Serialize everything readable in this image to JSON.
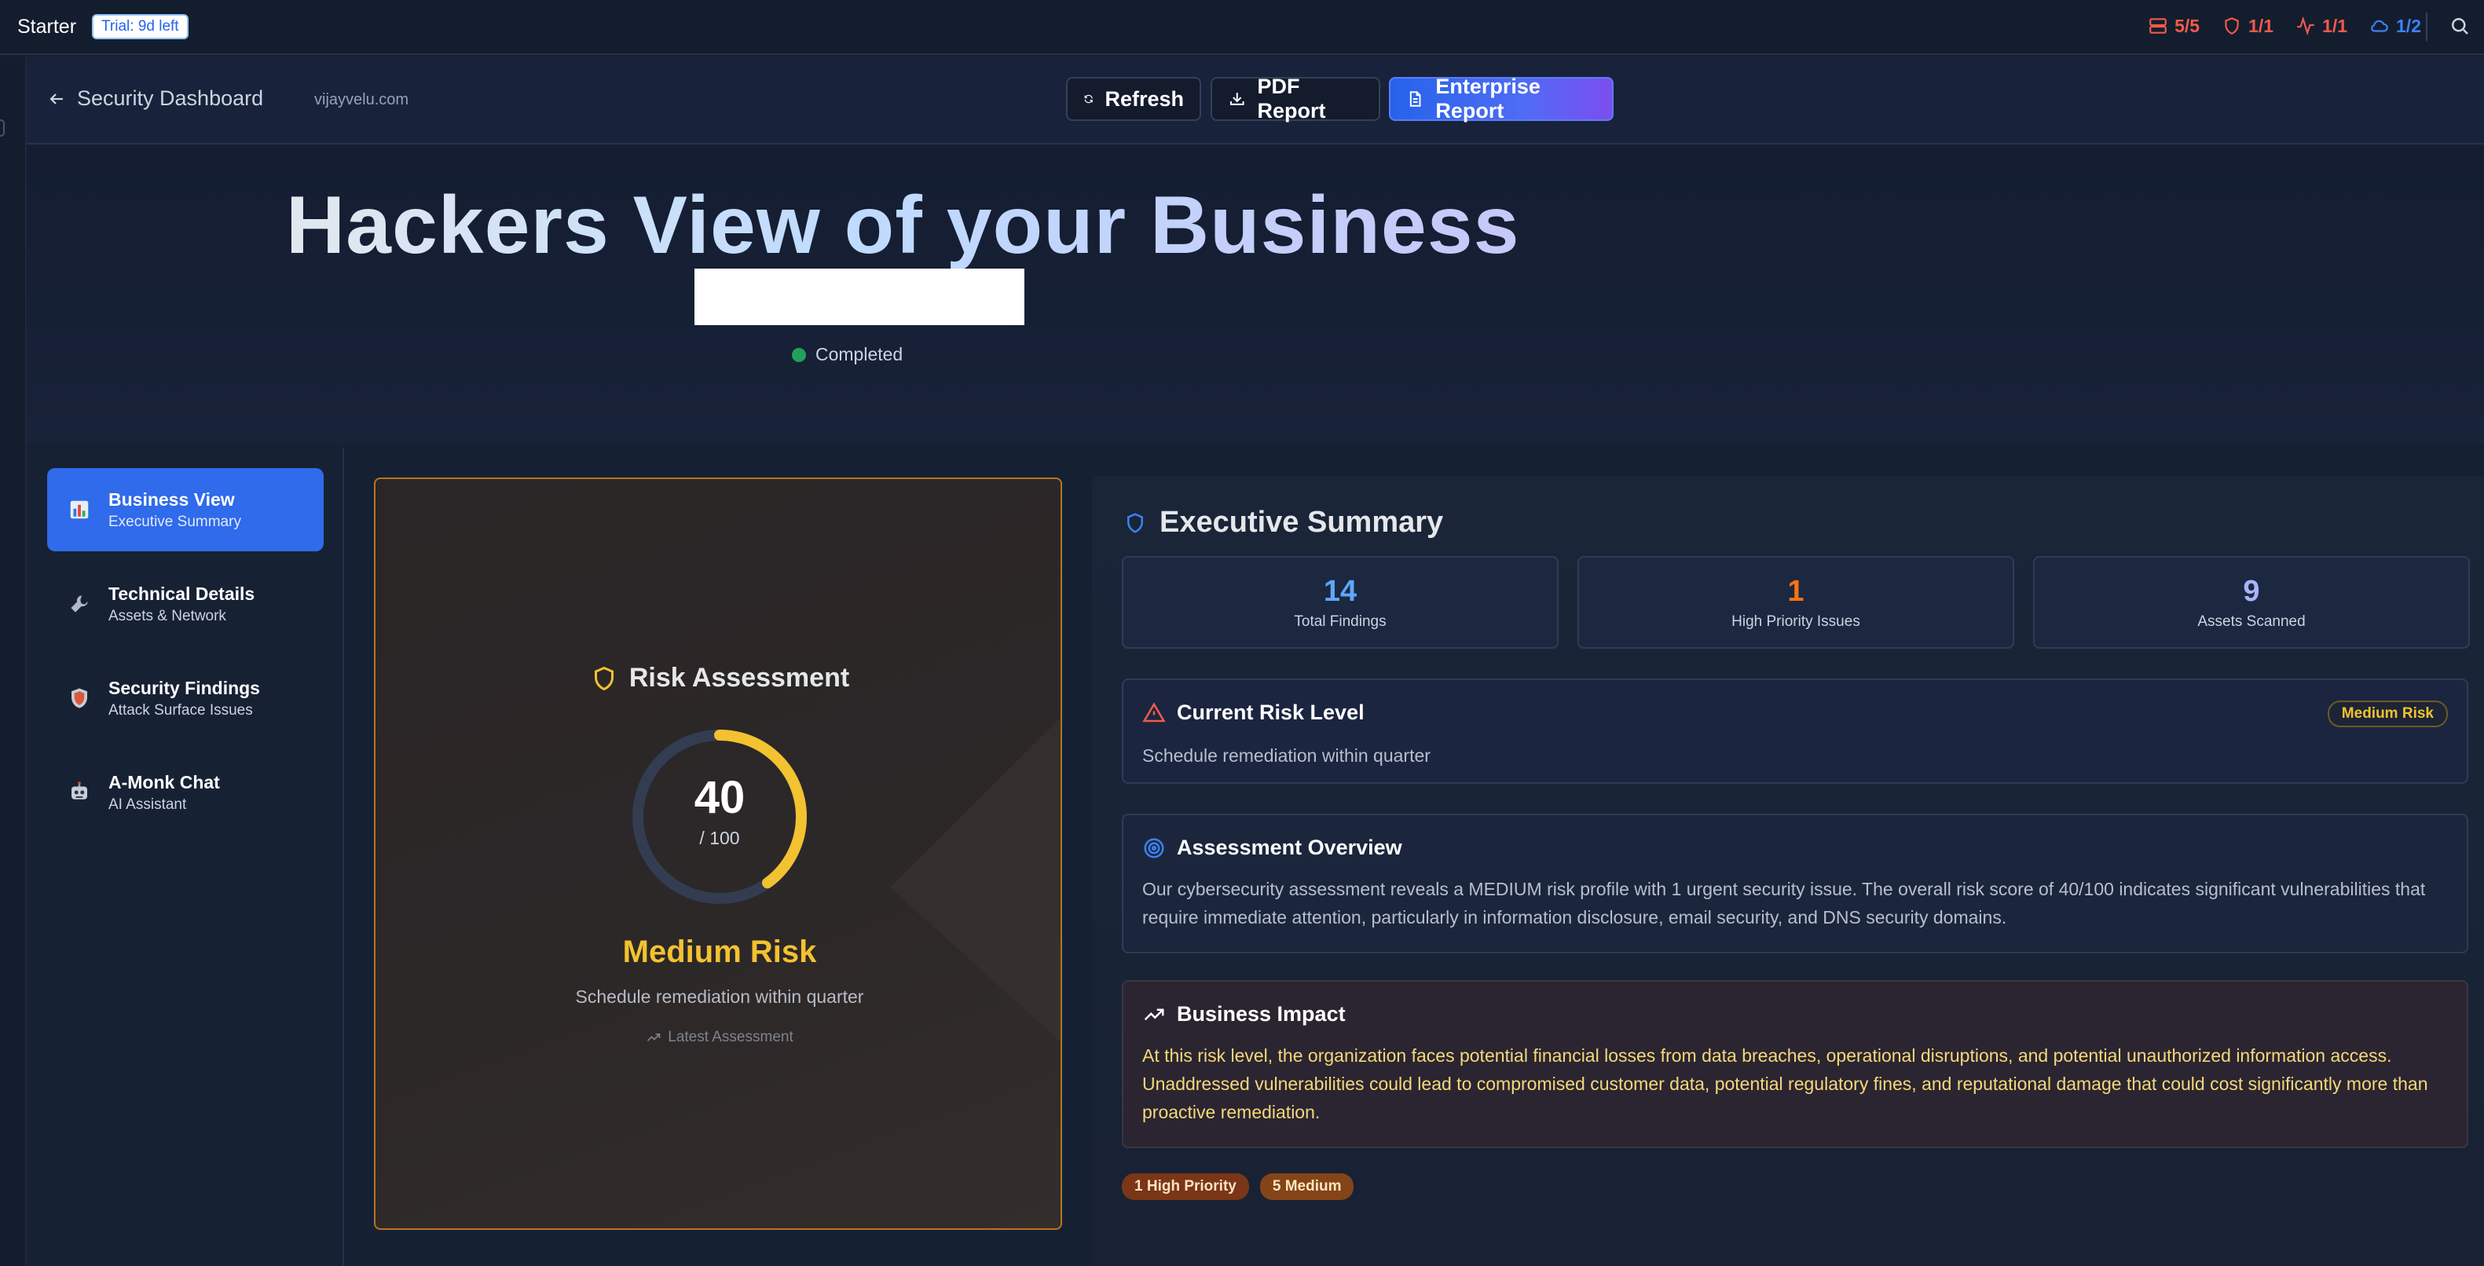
{
  "topbar": {
    "plan": "Starter",
    "trial": "Trial: 9d left",
    "stats": [
      {
        "icon": "server-icon",
        "value": "5/5",
        "color": "#f05a4a"
      },
      {
        "icon": "shield-icon",
        "value": "1/1",
        "color": "#f05a4a"
      },
      {
        "icon": "activity-icon",
        "value": "1/1",
        "color": "#f05a4a"
      },
      {
        "icon": "cloud-icon",
        "value": "1/2",
        "color": "#3b82f6"
      }
    ]
  },
  "header": {
    "back_label": "Security Dashboard",
    "domain": "vijayvelu.com",
    "refresh_label": "Refresh",
    "pdf_label": "PDF Report",
    "enterprise_label": "Enterprise Report"
  },
  "hero": {
    "title": "Hackers View of your Business",
    "status": "Completed",
    "status_color": "#22a05a"
  },
  "sidebar": {
    "items": [
      {
        "icon": "bar-chart-icon",
        "title": "Business View",
        "subtitle": "Executive Summary",
        "active": true
      },
      {
        "icon": "wrench-icon",
        "title": "Technical Details",
        "subtitle": "Assets & Network",
        "active": false
      },
      {
        "icon": "shield-badge-icon",
        "title": "Security Findings",
        "subtitle": "Attack Surface Issues",
        "active": false
      },
      {
        "icon": "robot-icon",
        "title": "A-Monk Chat",
        "subtitle": "AI Assistant",
        "active": false
      }
    ]
  },
  "risk": {
    "title": "Risk Assessment",
    "score": "40",
    "max": "/ 100",
    "score_fraction": 0.4,
    "level": "Medium Risk",
    "level_color": "#f2c230",
    "action": "Schedule remediation within quarter",
    "latest": "Latest Assessment"
  },
  "summary": {
    "title": "Executive Summary",
    "metrics": [
      {
        "value": "14",
        "label": "Total Findings",
        "color": "#60a5fa"
      },
      {
        "value": "1",
        "label": "High Priority Issues",
        "color": "#f97316"
      },
      {
        "value": "9",
        "label": "Assets Scanned",
        "color": "#a5b4fc"
      }
    ],
    "current_risk": {
      "title": "Current Risk Level",
      "text": "Schedule remediation within quarter",
      "badge": "Medium Risk"
    },
    "overview": {
      "title": "Assessment Overview",
      "text": "Our cybersecurity assessment reveals a MEDIUM risk profile with 1 urgent security issue. The overall risk score of 40/100 indicates significant vulnerabilities that require immediate attention, particularly in information disclosure, email security, and DNS security domains."
    },
    "impact": {
      "title": "Business Impact",
      "text": "At this risk level, the organization faces potential financial losses from data breaches, operational disruptions, and potential unauthorized information access. Unaddressed vulnerabilities could lead to compromised customer data, potential regulatory fines, and reputational damage that could cost significantly more than proactive remediation."
    },
    "tags": [
      "1 High Priority",
      "5 Medium"
    ]
  }
}
